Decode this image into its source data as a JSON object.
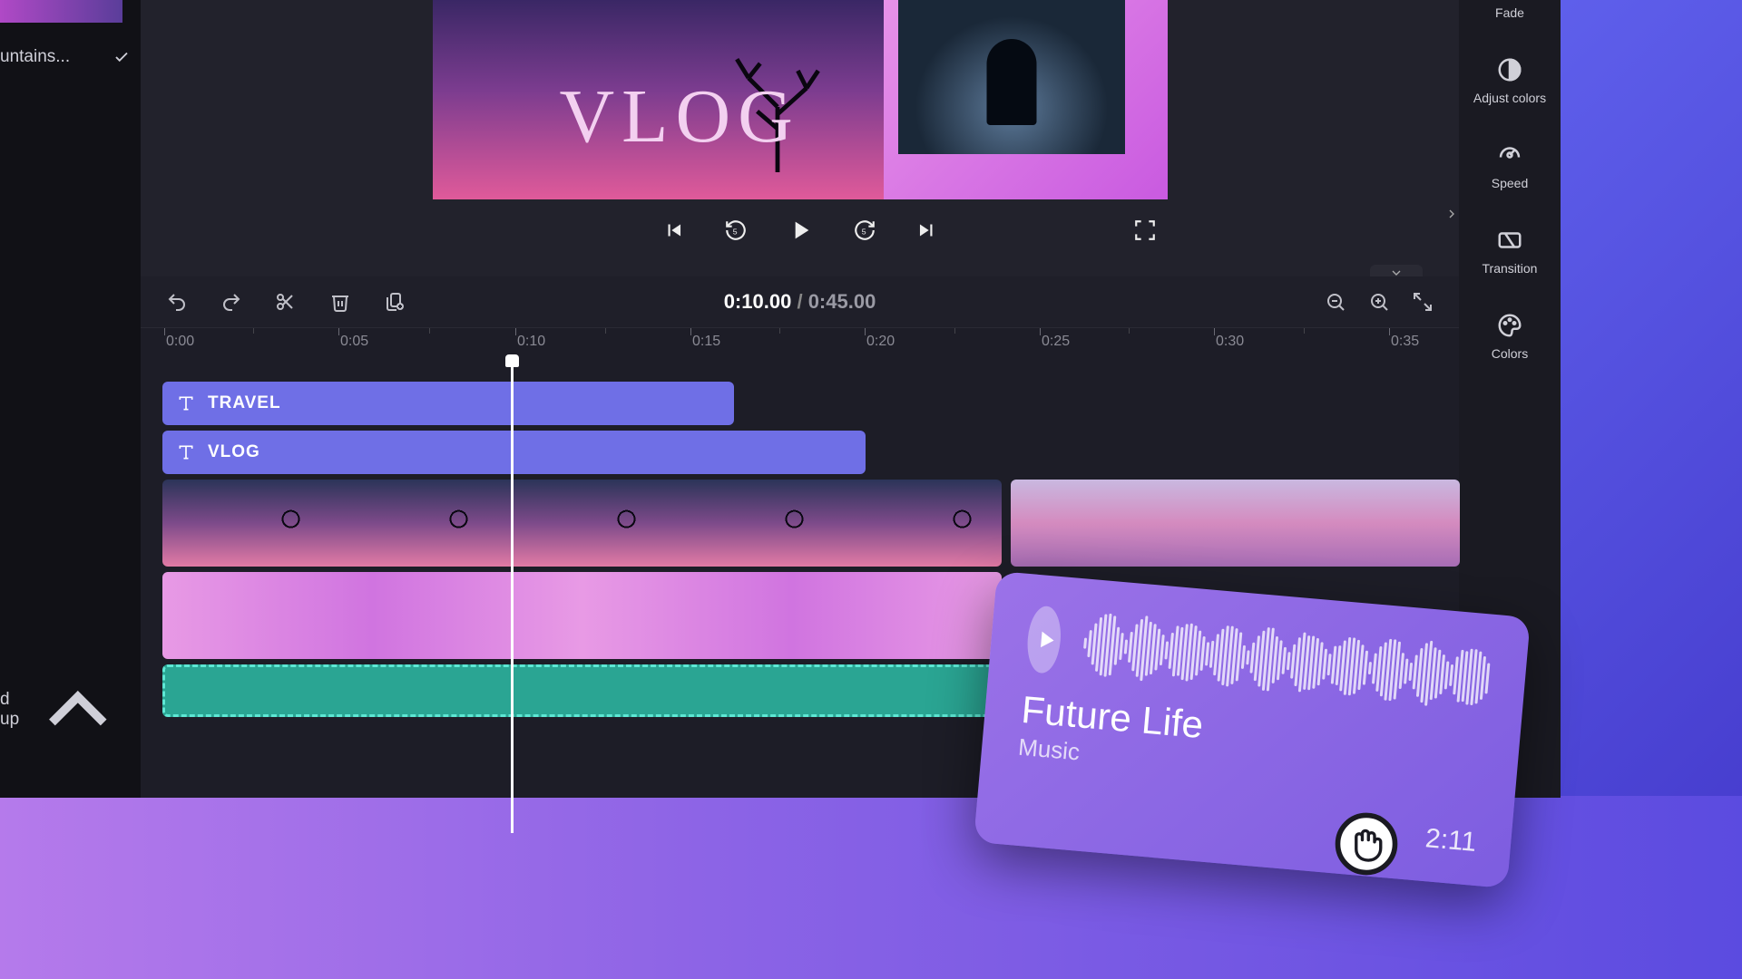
{
  "sidebar_left": {
    "item1_label": "untains...",
    "item2_label": "d up"
  },
  "preview": {
    "title_text": "VLOG"
  },
  "playback": {
    "current_time": "0:10.00",
    "separator": "/",
    "total_time": "0:45.00"
  },
  "ruler": {
    "ticks": [
      "0:00",
      "0:05",
      "0:10",
      "0:15",
      "0:20",
      "0:25",
      "0:30",
      "0:35"
    ]
  },
  "tracks": {
    "text1_label": "TRAVEL",
    "text2_label": "VLOG"
  },
  "right_tools": {
    "fade": "Fade",
    "adjust": "Adjust colors",
    "speed": "Speed",
    "transition": "Transition",
    "colors": "Colors"
  },
  "audio_card": {
    "title": "Future Life",
    "subtitle": "Music",
    "duration": "2:11"
  }
}
